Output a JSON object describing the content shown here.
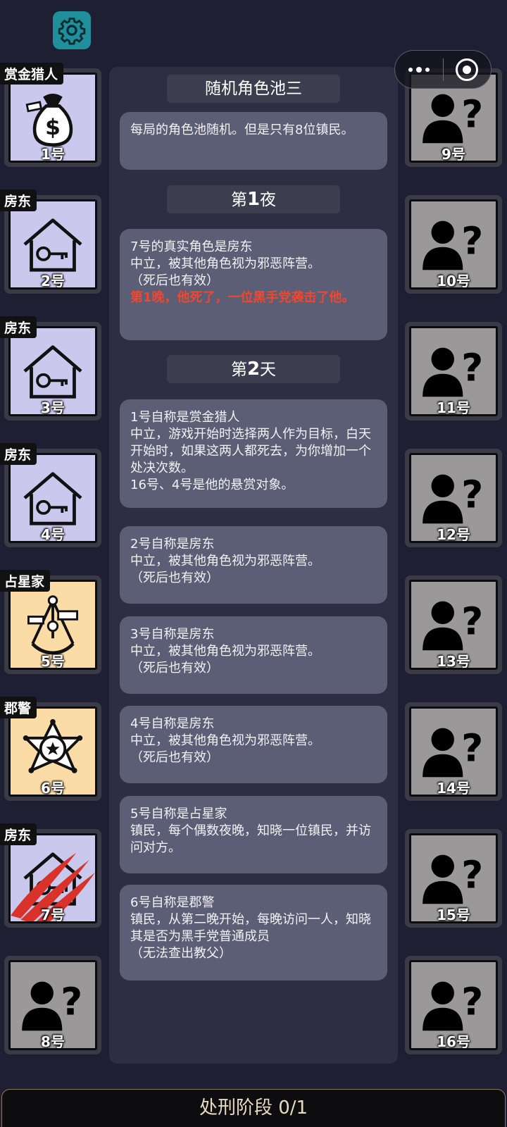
{
  "header": {
    "settings_icon": "gear-icon",
    "more_icon": "more-dots-icon",
    "close_icon": "target-icon"
  },
  "left_players": [
    {
      "num": "1号",
      "role": "赏金猎人",
      "icon": "money-bag-icon",
      "theme": "purple"
    },
    {
      "num": "2号",
      "role": "房东",
      "icon": "house-key-icon",
      "theme": "purple"
    },
    {
      "num": "3号",
      "role": "房东",
      "icon": "house-key-icon",
      "theme": "purple"
    },
    {
      "num": "4号",
      "role": "房东",
      "icon": "house-key-icon",
      "theme": "purple"
    },
    {
      "num": "5号",
      "role": "占星家",
      "icon": "sextant-icon",
      "theme": "orange"
    },
    {
      "num": "6号",
      "role": "郡警",
      "icon": "sheriff-star-icon",
      "theme": "orange"
    },
    {
      "num": "7号",
      "role": "房东",
      "icon": "house-key-icon",
      "theme": "purple",
      "dead": true
    },
    {
      "num": "8号",
      "role": "",
      "icon": "unknown-person-icon",
      "theme": "grey"
    }
  ],
  "right_players": [
    {
      "num": "9号",
      "icon": "unknown-person-icon"
    },
    {
      "num": "10号",
      "icon": "unknown-person-icon"
    },
    {
      "num": "11号",
      "icon": "unknown-person-icon"
    },
    {
      "num": "12号",
      "icon": "unknown-person-icon"
    },
    {
      "num": "13号",
      "icon": "unknown-person-icon"
    },
    {
      "num": "14号",
      "icon": "unknown-person-icon"
    },
    {
      "num": "15号",
      "icon": "unknown-person-icon"
    },
    {
      "num": "16号",
      "icon": "unknown-person-icon"
    }
  ],
  "log": {
    "title": "随机角色池三",
    "intro": "每局的角色池随机。但是只有8位镇民。",
    "night1": {
      "prefix": "第",
      "num": "1",
      "suffix": "夜"
    },
    "night1_msg": {
      "l1": "7号的真实角色是房东",
      "l2": "中立，被其他角色视为邪恶阵营。",
      "l3": "（死后也有效）",
      "red": "第1晚，他死了，一位黑手党袭击了他。"
    },
    "day2": {
      "prefix": "第",
      "num": "2",
      "suffix": "天"
    },
    "msgs": [
      {
        "l1": "1号自称是赏金猎人",
        "l2": "中立，游戏开始时选择两人作为目标，白天开始时，如果这两人都死去，为你增加一个处决次数。",
        "l3": "16号、4号是他的悬赏对象。"
      },
      {
        "l1": "2号自称是房东",
        "l2": "中立，被其他角色视为邪恶阵营。",
        "l3": "（死后也有效）"
      },
      {
        "l1": "3号自称是房东",
        "l2": "中立，被其他角色视为邪恶阵营。",
        "l3": "（死后也有效）"
      },
      {
        "l1": "4号自称是房东",
        "l2": "中立，被其他角色视为邪恶阵营。",
        "l3": "（死后也有效）"
      },
      {
        "l1": "5号自称是占星家",
        "l2": "镇民，每个偶数夜晚，知晓一位镇民，并访问对方。",
        "l3": ""
      },
      {
        "l1": "6号自称是郡警",
        "l2": "镇民，从第二晚开始，每晚访问一人，知晓其是否为黑手党普通成员",
        "l3": "（无法查出教父）"
      }
    ]
  },
  "footer": {
    "phase": "处刑阶段 0/1"
  }
}
